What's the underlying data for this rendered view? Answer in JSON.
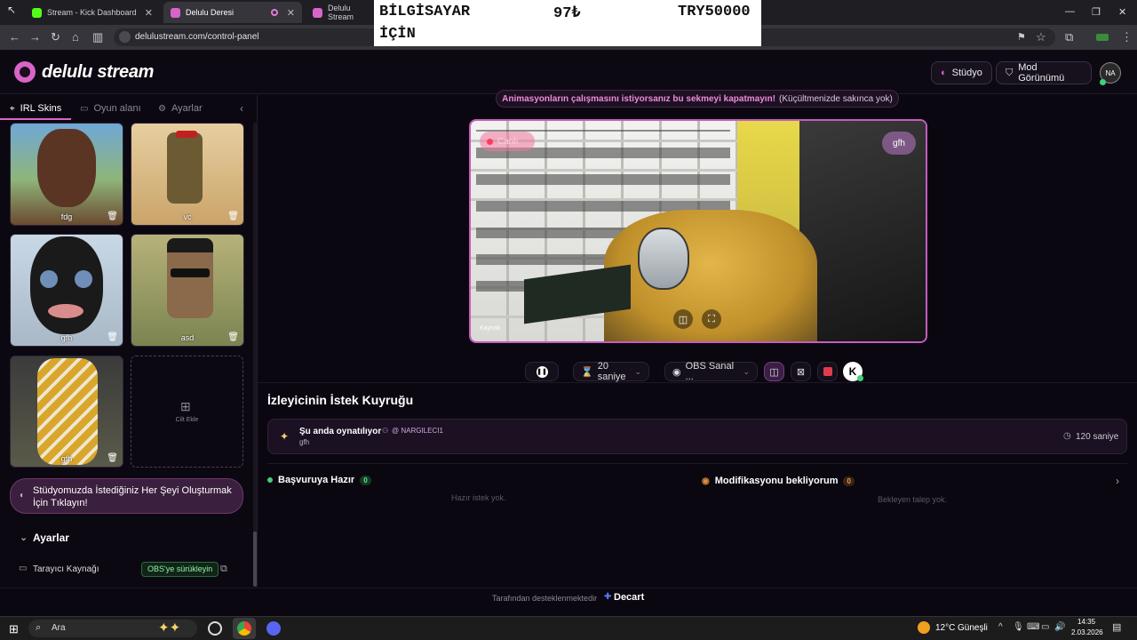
{
  "browser": {
    "tabs": [
      {
        "title": "Stream - Kick Dashboard",
        "active": false
      },
      {
        "title": "Delulu Deresi",
        "active": true
      },
      {
        "title": "Delulu Stream",
        "active": false
      }
    ],
    "url": "delulustream.com/control-panel"
  },
  "overlay": {
    "product_line1": "BİLGİSAYAR",
    "product_line2": "İÇİN",
    "price": "97₺",
    "goal": "TRY50000"
  },
  "header": {
    "logo_text": "delulu stream",
    "studio_label": "Stüdyo",
    "mod_view_label": "Mod Görünümü",
    "avatar_text": "NA"
  },
  "sidebar": {
    "tabs": [
      {
        "label": "IRL Skins",
        "icon": "skin-icon"
      },
      {
        "label": "Oyun alanı",
        "icon": "gamepad-icon"
      },
      {
        "label": "Ayarlar",
        "icon": "gear-icon"
      }
    ],
    "skins": [
      {
        "label": "fdg"
      },
      {
        "label": "vc"
      },
      {
        "label": "gfh"
      },
      {
        "label": "asd"
      },
      {
        "label": "gfh"
      }
    ],
    "add_skin_label": "Cilt Ekle",
    "promo_text": "Stüdyomuzda İstediğiniz Her Şeyi Oluşturmak İçin Tıklayın!",
    "settings_title": "Ayarlar",
    "browser_source_label": "Tarayıcı Kaynağı",
    "obs_drag_label": "OBS'ye sürükleyin"
  },
  "main": {
    "notice_bold": "Animasyonların çalışmasını istiyorsanız bu sekmeyi kapatmayın!",
    "notice_rest": "(Küçültmenizde sakınca yok)",
    "preview_live_label": "Canlı",
    "preview_skin_badge": "gfh",
    "preview_source_label": "Kaynak",
    "controls": {
      "duration": "20 saniye",
      "camera": "OBS Sanal ..."
    },
    "queue_title": "İzleyicinin İstek Kuyruğu",
    "now_playing_title": "Şu anda oynatılıyor",
    "now_playing_user": "@ NARGILECI1",
    "now_playing_skin": "gfh",
    "now_playing_time": "120 saniye",
    "ready_title": "Başvuruya Hazır",
    "ready_count": "0",
    "ready_empty": "Hazır istek yok.",
    "waiting_title": "Modifikasyonu bekliyorum",
    "waiting_count": "0",
    "waiting_empty": "Bekleyen talep yok."
  },
  "footer": {
    "powered_text": "Tarafından desteklenmektedir",
    "brand": "Decart"
  },
  "taskbar": {
    "search_label": "Ara",
    "weather": "12°C",
    "weather_desc": "Güneşli",
    "time": "14:35",
    "date": "2.03.2026"
  },
  "colors": {
    "accent": "#d964c9",
    "background": "#0b0710",
    "ready_dot": "#3fd07a",
    "waiting_icon": "#e08a3c"
  }
}
